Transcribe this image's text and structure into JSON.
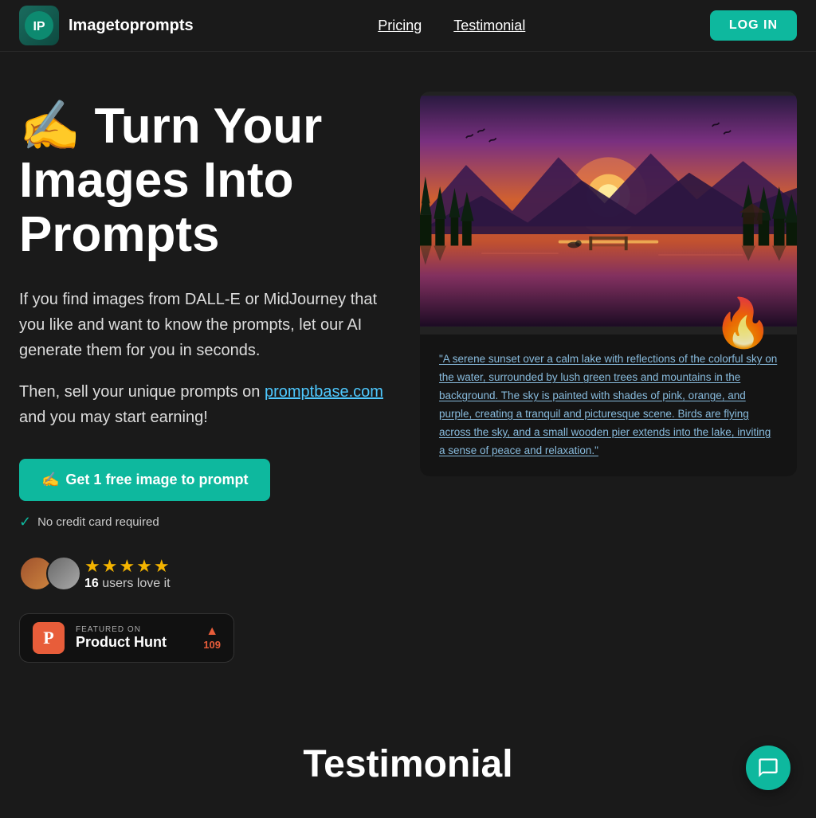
{
  "brand": {
    "name": "Imagetoprompts"
  },
  "nav": {
    "pricing_label": "Pricing",
    "testimonial_label": "Testimonial",
    "login_label": "LOG IN"
  },
  "hero": {
    "title_icon": "✍️",
    "title_text": "Turn Your Images Into Prompts",
    "description1": "If you find images from DALL-E or MidJourney that you like and want to know the prompts, let our AI generate them for you in seconds.",
    "description2_prefix": "Then, sell your unique prompts on ",
    "description2_link": "promptbase.com",
    "description2_suffix": " and you may start earning!",
    "cta_icon": "✍️",
    "cta_label": "Get 1 free image to prompt",
    "no_credit": "No credit card required",
    "users_count": "16",
    "users_suffix": " users love it",
    "stars": "★★★★★",
    "image_caption": "\"A serene sunset over a calm lake with reflections of the colorful sky on the water, surrounded by lush green trees and mountains in the background. The sky is painted with shades of pink, orange, and purple, creating a tranquil and picturesque scene. Birds are flying across the sky, and a small wooden pier extends into the lake, inviting a sense of peace and relaxation.\""
  },
  "product_hunt": {
    "featured_label": "FEATURED ON",
    "name": "Product Hunt",
    "upvotes": "109"
  },
  "testimonial": {
    "title": "Testimonial"
  },
  "colors": {
    "teal": "#0eb89e",
    "dark_bg": "#1a1a1a",
    "ph_orange": "#e85d3a"
  }
}
